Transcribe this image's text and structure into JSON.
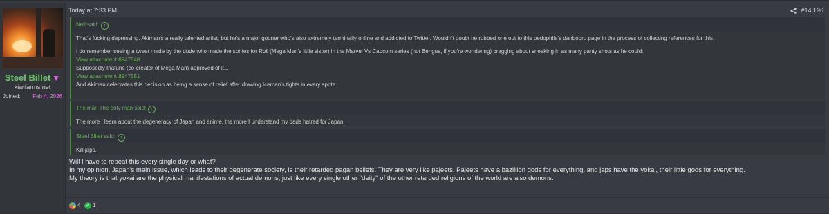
{
  "user": {
    "name": "Steel Billet",
    "badge_symbol": "▼",
    "title": "kiwifarms.net",
    "joined_label": "Joined:",
    "joined_date": "Feb 4, 2026",
    "avatar": "avatar-image"
  },
  "post": {
    "timestamp": "Today at 7:33 PM",
    "number": "#14,196",
    "share_icon": "share-icon"
  },
  "quotes": [
    {
      "author": "Neil said:",
      "lines": [
        {
          "text": "That's fucking depressing. Akiman's a really talented artist, but he's a major gooner who's also extremely terminally online and addicted to Twitter. Wouldn't doubt he rubbed one out to this pedophile's danbooru page in the process of collecting references for this.",
          "type": "text"
        },
        {
          "text": "",
          "type": "gap"
        },
        {
          "text": "I do remember seeing a tweet made by the dude who made the sprites for Roll (Mega Man's little sister) in the Marvel Vs Capcom series (not Bengus, if you're wondering) bragging about sneaking in as many panty shots as he could:",
          "type": "text"
        },
        {
          "text": "View attachment 8947548",
          "type": "attach"
        },
        {
          "text": "Supposedly Inafune (co-creator of Mega Man) approved of it...",
          "type": "text"
        },
        {
          "text": "View attachment 8947551",
          "type": "attach"
        },
        {
          "text": "And Akiman celebrates this decision as being a sense of relief after drawing Iceman's tights in every sprite.",
          "type": "text"
        }
      ]
    },
    {
      "author": "The man The only man said:",
      "lines": [
        {
          "text": "The more I learn about the degeneracy of Japan and anime, the more I understand my dads hatred for Japan.",
          "type": "text"
        }
      ]
    },
    {
      "author": "Steel Billet said:",
      "lines": [
        {
          "text": "Kill japs.",
          "type": "text"
        }
      ]
    }
  ],
  "reply": {
    "lines": [
      "Will I have to repeat this every single day or what?",
      "In my opinion, Japan's main issue, which leads to their degenerate society, is their retarded pagan beliefs. They are very like pajeets. Pajeets have a bazillion gods for everything, and japs have the yokai, their little gods for everything.",
      "My theory is that yokai are the physical manifestations of actual demons, just like every single other \"deity\" of the other retarded religions of the world are also demons."
    ]
  },
  "reactions": [
    {
      "icon": "rainbow-reaction-icon",
      "count": "4"
    },
    {
      "icon": "check-reaction-icon",
      "count": "1",
      "symbol": "✓"
    }
  ],
  "colors": {
    "username": "#6fc36b",
    "badge": "#e06de0",
    "quote_accent": "#4b8b3b",
    "attachment_link": "#6aab5a"
  }
}
